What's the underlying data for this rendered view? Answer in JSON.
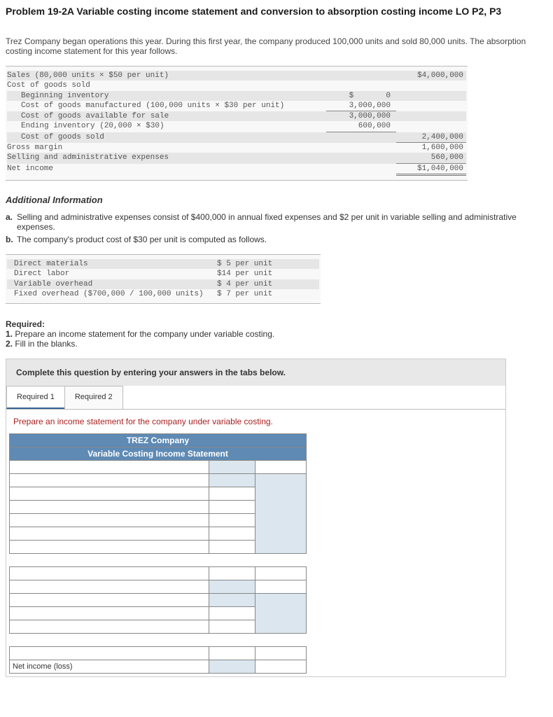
{
  "title": "Problem 19-2A Variable costing income statement and conversion to absorption costing income LO P2, P3",
  "intro": "Trez Company began operations this year. During this first year, the company produced 100,000 units and sold 80,000 units. The absorption costing income statement for this year follows.",
  "stmt": {
    "sales_label": "Sales (80,000 units × $50 per unit)",
    "sales_amt": "$4,000,000",
    "cogs_label": "Cost of goods sold",
    "beg_inv_label": "Beginning inventory",
    "beg_inv_sym": "$",
    "beg_inv_amt": "0",
    "cogm_label": "Cost of goods manufactured (100,000 units × $30 per unit)",
    "cogm_amt": "3,000,000",
    "avail_label": "Cost of goods available for sale",
    "avail_amt": "3,000,000",
    "end_inv_label": "Ending inventory (20,000 × $30)",
    "end_inv_amt": "600,000",
    "cogs_total_label": "Cost of goods sold",
    "cogs_total_amt": "2,400,000",
    "gross_label": "Gross margin",
    "gross_amt": "1,600,000",
    "sga_label": "Selling and administrative expenses",
    "sga_amt": "560,000",
    "net_label": "Net income",
    "net_amt": "$1,040,000"
  },
  "addl_header": "Additional Information",
  "addl_a": "Selling and administrative expenses consist of $400,000 in annual fixed expenses and $2 per unit in variable selling and administrative expenses.",
  "addl_b": "The company's product cost of $30 per unit is computed as follows.",
  "costs": {
    "dm_l": "Direct materials",
    "dm_v": "$ 5 per unit",
    "dl_l": "Direct labor",
    "dl_v": "$14 per unit",
    "voh_l": "Variable overhead",
    "voh_v": "$ 4 per unit",
    "foh_l": "Fixed overhead ($700,000 / 100,000 units)",
    "foh_v": "$ 7 per unit"
  },
  "required_header": "Required:",
  "req1": "1. Prepare an income statement for the company under variable costing.",
  "req2": "2. Fill in the blanks.",
  "answerbox": {
    "head": "Complete this question by entering your answers in the tabs below.",
    "tab1": "Required 1",
    "tab2": "Required 2",
    "instr": "Prepare an income statement for the company under variable costing.",
    "company": "TREZ Company",
    "stmt_title": "Variable Costing Income Statement",
    "net_income": "Net income (loss)"
  }
}
